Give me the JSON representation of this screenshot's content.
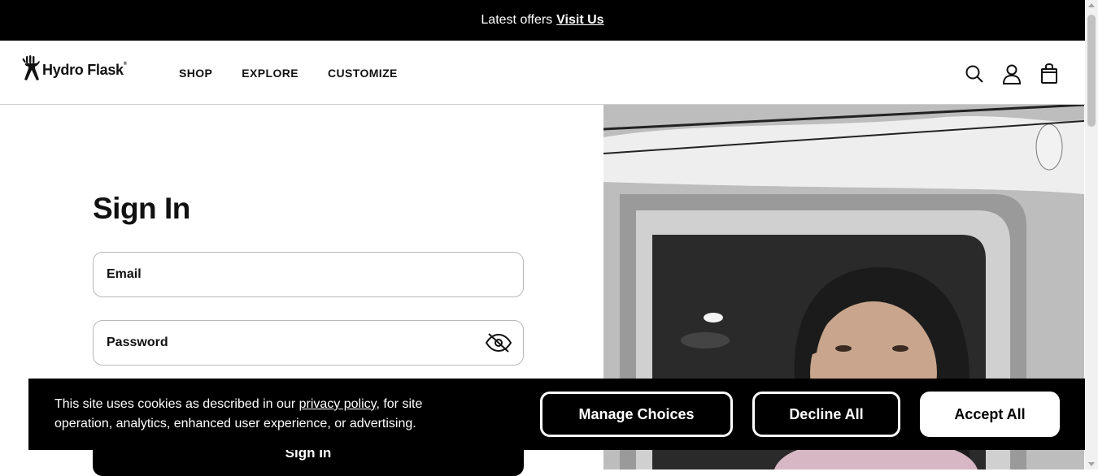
{
  "announcement": {
    "text": "Latest offers",
    "link": "Visit Us"
  },
  "header": {
    "brand": "Hydro Flask",
    "nav": [
      "SHOP",
      "EXPLORE",
      "CUSTOMIZE"
    ]
  },
  "signin": {
    "title": "Sign In",
    "email_placeholder": "Email",
    "password_placeholder": "Password",
    "button": "Sign In"
  },
  "cookie": {
    "text_before": "This site uses cookies as described in our",
    "link": "privacy policy",
    "text_after": ", for site operation, analytics, enhanced user experience, or advertising.",
    "manage": "Manage Choices",
    "decline": "Decline All",
    "accept": "Accept All"
  },
  "colors": {
    "black": "#000000",
    "white": "#ffffff",
    "border": "#b8b8b8"
  },
  "icons": [
    "hydro-flask-logo-icon",
    "search-icon",
    "account-icon",
    "bag-icon",
    "eye-slash-icon"
  ]
}
